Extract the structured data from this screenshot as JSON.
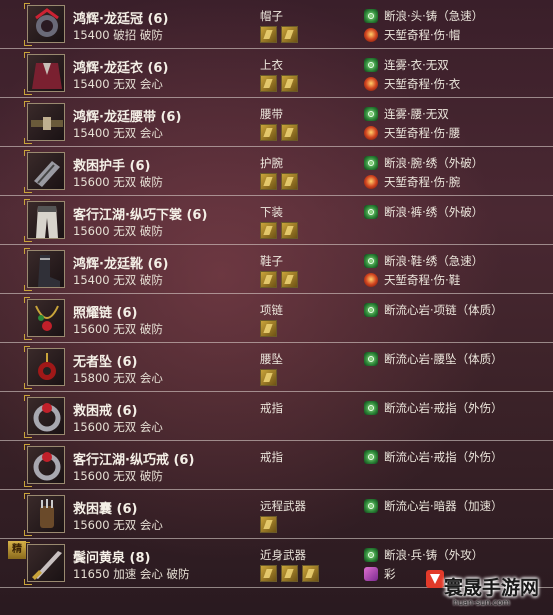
{
  "rows": [
    {
      "name": "鸿辉·龙廷冠 (6)",
      "stats": "15400 破招 破防",
      "slot": "帽子",
      "stones": 2,
      "icon": "hat-icon",
      "effect1": "断浪·头·铸（急速）",
      "effect2": "天堑奇程·伤·帽",
      "e2": "red"
    },
    {
      "name": "鸿辉·龙廷衣 (6)",
      "stats": "15400 无双 会心",
      "slot": "上衣",
      "stones": 2,
      "icon": "robe-icon",
      "effect1": "连雾·衣·无双",
      "effect2": "天堑奇程·伤·衣",
      "e2": "red"
    },
    {
      "name": "鸿辉·龙廷腰带 (6)",
      "stats": "15400 无双 会心",
      "slot": "腰带",
      "stones": 2,
      "icon": "belt-icon",
      "effect1": "连雾·腰·无双",
      "effect2": "天堑奇程·伤·腰",
      "e2": "red"
    },
    {
      "name": "救困护手 (6)",
      "stats": "15600 无双 破防",
      "slot": "护腕",
      "stones": 2,
      "icon": "bracer-icon",
      "effect1": "断浪·腕·绣（外破）",
      "effect2": "天堑奇程·伤·腕",
      "e2": "red"
    },
    {
      "name": "客行江湖·纵巧下裳 (6)",
      "stats": "15600 无双 破防",
      "slot": "下装",
      "stones": 2,
      "icon": "pants-icon",
      "effect1": "断浪·裤·绣（外破）",
      "effect2": "",
      "e2": ""
    },
    {
      "name": "鸿辉·龙廷靴 (6)",
      "stats": "15400 无双 破防",
      "slot": "鞋子",
      "stones": 2,
      "icon": "boots-icon",
      "effect1": "断浪·鞋·绣（急速）",
      "effect2": "天堑奇程·伤·鞋",
      "e2": "red"
    },
    {
      "name": "照耀链 (6)",
      "stats": "15600 无双 破防",
      "slot": "项链",
      "stones": 1,
      "icon": "necklace-icon",
      "effect1": "断流心岩·项链（体质）",
      "effect2": "",
      "e2": ""
    },
    {
      "name": "无者坠 (6)",
      "stats": "15800 无双 会心",
      "slot": "腰坠",
      "stones": 1,
      "icon": "pendant-icon",
      "effect1": "断流心岩·腰坠（体质）",
      "effect2": "",
      "e2": ""
    },
    {
      "name": "救困戒 (6)",
      "stats": "15600 无双 会心",
      "slot": "戒指",
      "stones": 0,
      "icon": "ring-icon",
      "effect1": "断流心岩·戒指（外伤）",
      "effect2": "",
      "e2": ""
    },
    {
      "name": "客行江湖·纵巧戒 (6)",
      "stats": "15600 无双 破防",
      "slot": "戒指",
      "stones": 0,
      "icon": "ring-icon",
      "effect1": "断流心岩·戒指（外伤）",
      "effect2": "",
      "e2": ""
    },
    {
      "name": "救困囊 (6)",
      "stats": "15600 无双 会心",
      "slot": "远程武器",
      "stones": 1,
      "icon": "quiver-icon",
      "effect1": "断流心岩·暗器（加速）",
      "effect2": "",
      "e2": ""
    },
    {
      "name": "鬓问黄泉 (8)",
      "stats": "11650 加速 会心 破防",
      "slot": "近身武器",
      "stones": 3,
      "icon": "blade-icon",
      "effect1": "断浪·兵·铸（外攻）",
      "effect2": "彩",
      "e2": "purple",
      "badge": "精"
    }
  ],
  "watermark": {
    "title": "寰晟手游网",
    "url": "huan-sun.com"
  },
  "colors": {
    "accent": "#c9a43a",
    "effect_green": "#2f8a3a",
    "effect_red": "#d14420"
  }
}
